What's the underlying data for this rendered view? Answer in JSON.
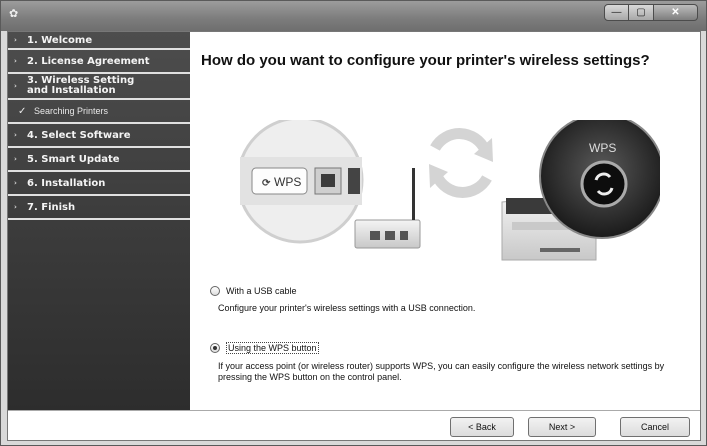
{
  "window": {
    "min_glyph": "—",
    "max_glyph": "▢",
    "close_glyph": "✕"
  },
  "sidebar": {
    "items": [
      {
        "label": "1. Welcome"
      },
      {
        "label": "2. License Agreement"
      },
      {
        "label": "3. Wireless Setting and Installation"
      },
      {
        "label": "4. Select Software"
      },
      {
        "label": "5. Smart Update"
      },
      {
        "label": "6. Installation"
      },
      {
        "label": "7. Finish"
      }
    ],
    "sub_item": {
      "label": "Searching Printers"
    }
  },
  "main": {
    "heading": "How do you want to configure your printer's wireless settings?",
    "illustration": {
      "button_label": "WPS",
      "badge_label": "WPS"
    },
    "options": [
      {
        "label": "With a USB cable",
        "checked": false,
        "description": "Configure your printer's wireless settings with a USB connection."
      },
      {
        "label": "Using the WPS button",
        "checked": true,
        "description": "If your access point (or wireless router) supports WPS, you can easily configure the wireless network settings by pressing the WPS button on the control panel."
      }
    ]
  },
  "footer": {
    "back_label": "< Back",
    "next_label": "Next >",
    "cancel_label": "Cancel"
  }
}
